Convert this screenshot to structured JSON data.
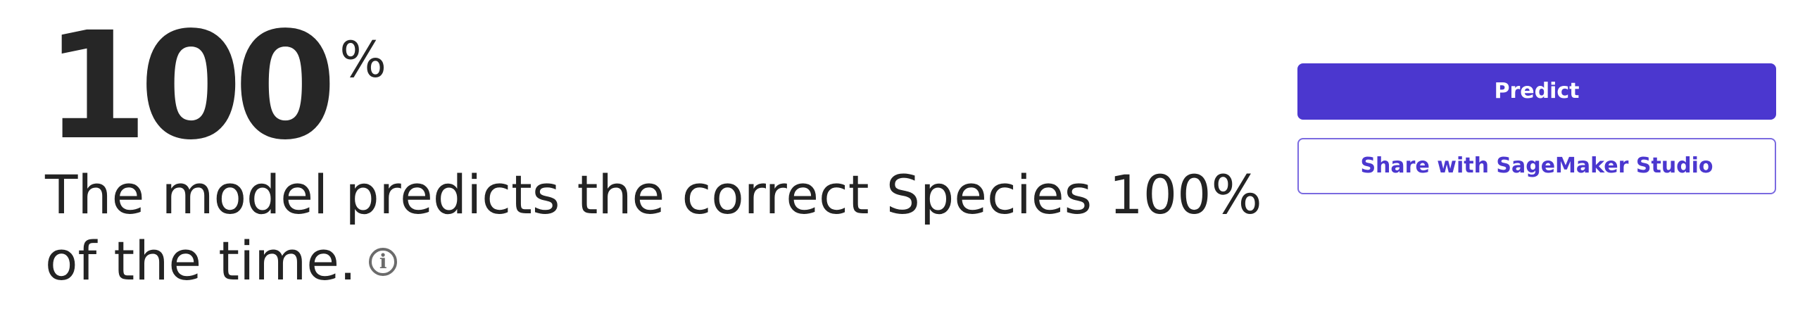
{
  "metric": {
    "value": "100",
    "unit": "%"
  },
  "description": {
    "text": "The model predicts the correct Species 100% of the time.",
    "info_icon_glyph": "i"
  },
  "actions": {
    "predict_label": "Predict",
    "share_label": "Share with SageMaker Studio"
  },
  "colors": {
    "accent": "#4b37cf",
    "text": "#232323",
    "icon": "#6b6b6b"
  }
}
